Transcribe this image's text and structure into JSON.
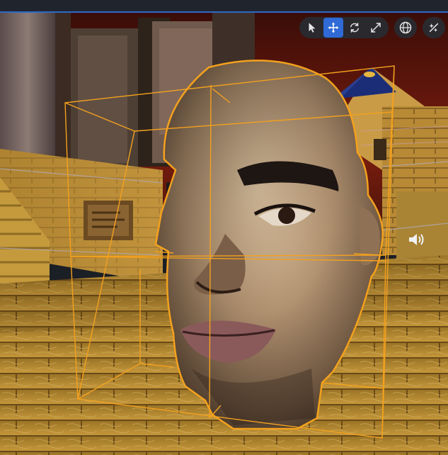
{
  "colors": {
    "selection_outline": "#f3a11e",
    "active_tool": "#2f6ad6",
    "topbar_accent": "#2f68c8",
    "toolbar_bg": "#282b32"
  },
  "toolbar": {
    "tools": [
      {
        "name": "select",
        "icon": "cursor-arrow-icon",
        "active": false
      },
      {
        "name": "move",
        "icon": "move-arrows-icon",
        "active": true
      },
      {
        "name": "rotate",
        "icon": "rotate-icon",
        "active": false
      },
      {
        "name": "scale",
        "icon": "scale-icon",
        "active": false
      }
    ],
    "space_toggle_icon": "globe-icon",
    "extra_icon": "snap-transform-icon"
  },
  "scene": {
    "selected_object": "head-model",
    "audio_source_icon": "speaker-icon"
  }
}
